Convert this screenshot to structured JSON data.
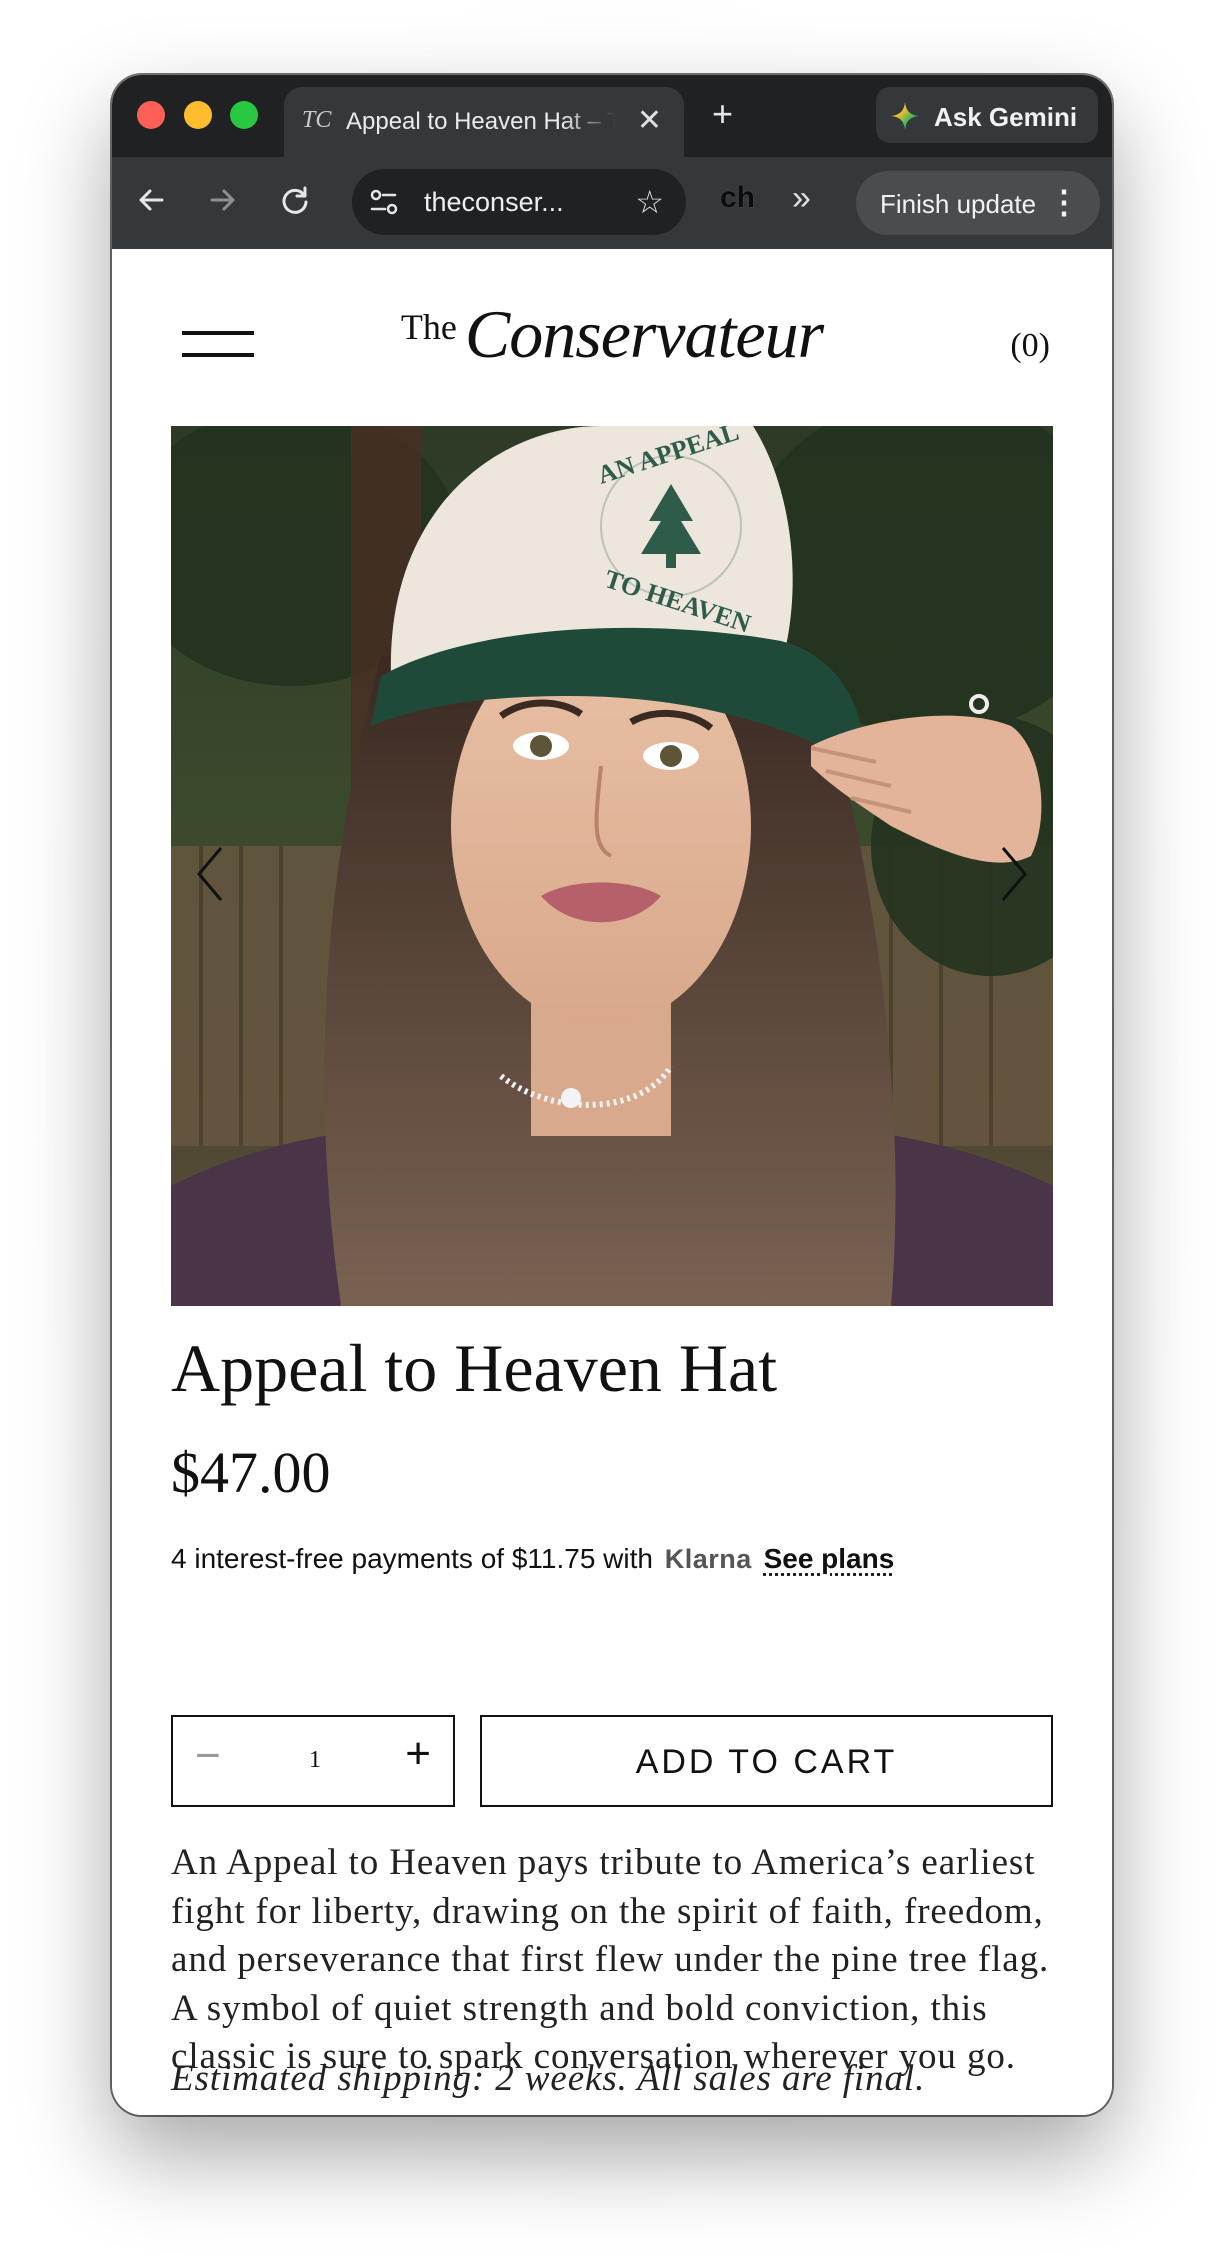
{
  "browser": {
    "tab": {
      "favicon_text": "TC",
      "title": "Appeal to Heaven Hat – The Conservateur",
      "close_glyph": "✕"
    },
    "new_tab_glyph": "+",
    "gemini_label": "Ask Gemini",
    "address": "theconser...",
    "extension_label": "ch",
    "overflow_glyph": "»",
    "finish_update_label": "Finish update",
    "menu_glyph": "⋮"
  },
  "site": {
    "logo_the": "The",
    "logo_name": "Conservateur",
    "cart_count": "(0)"
  },
  "product": {
    "image_alt": "Woman wearing a cream and green cap embroidered with a pine tree and the words An Appeal to Heaven",
    "hat_text_top": "AN APPEAL",
    "hat_text_bottom": "TO HEAVEN",
    "title": "Appeal to Heaven Hat",
    "price": "$47.00",
    "installments_text": "4 interest-free payments of $11.75 with",
    "klarna_label": "Klarna",
    "see_plans_label": "See plans",
    "quantity": "1",
    "add_to_cart_label": "ADD TO CART",
    "description": "An Appeal to Heaven pays tribute to America’s earliest fight for liberty, drawing on the spirit of faith, freedom, and perseverance that first flew under the pine tree flag. A symbol of quiet strength and bold conviction, this classic is sure to spark conversation wherever you go.",
    "shipping_note": "Estimated shipping: 2 weeks. All sales are final."
  },
  "colors": {
    "chrome_dark": "#1f2123",
    "chrome_toolbar": "#35383b",
    "text": "#111111",
    "hat_green": "#1f4a3a",
    "sweater_purple": "#4a3448"
  }
}
